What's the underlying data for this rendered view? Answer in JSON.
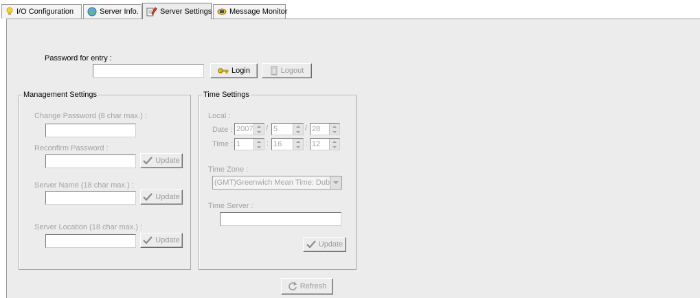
{
  "tabs": [
    {
      "label": "I/O Configuration",
      "icon": "lightbulb-icon"
    },
    {
      "label": "Server Info.",
      "icon": "server-info-icon"
    },
    {
      "label": "Server Settings",
      "icon": "edit-settings-icon"
    },
    {
      "label": "Message Monitor",
      "icon": "message-monitor-icon"
    }
  ],
  "entry": {
    "password_label": "Password for entry :",
    "password_value": "",
    "login_label": "Login",
    "logout_label": "Logout"
  },
  "management": {
    "title": "Management Settings",
    "change_password_label": "Change Password (8 char max.) :",
    "change_password_value": "",
    "reconfirm_label": "Reconfirm Password :",
    "reconfirm_value": "",
    "server_name_label": "Server Name (18 char max.) :",
    "server_name_value": "",
    "server_location_label": "Server Location (18 char max.) :",
    "server_location_value": "",
    "update_label": "Update"
  },
  "time": {
    "title": "Time Settings",
    "local_label": "Local :",
    "date_label": "Date :",
    "year": "2007",
    "month": "5",
    "day": "28",
    "date_sep": "/",
    "time_label": "Time :",
    "hour": "1",
    "minute": "16",
    "second": "12",
    "time_sep": ":",
    "timezone_label": "Time Zone :",
    "timezone_value": "(GMT)Greenwich Mean Time: Dub",
    "time_server_label": "Time Server :",
    "time_server_value": "",
    "update_label": "Update"
  },
  "refresh_label": "Refresh",
  "colors": {
    "panel": "#ececec",
    "disabled_text": "#a3a3a3"
  }
}
